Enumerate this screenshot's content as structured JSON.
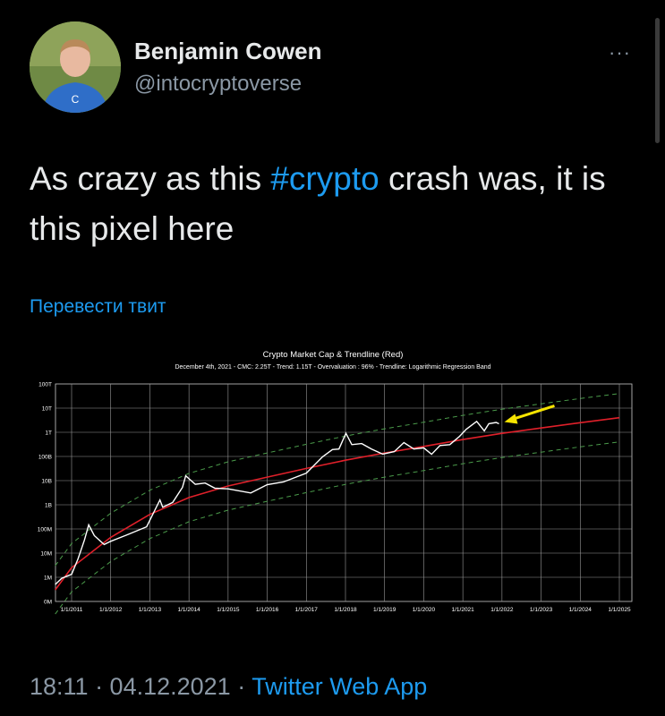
{
  "author": {
    "name": "Benjamin Cowen",
    "handle": "@intocryptoverse",
    "avatar_shirt_logo": "C"
  },
  "menu": {
    "label": "···",
    "icon": "more-dots-icon"
  },
  "tweet": {
    "text_part1": "As crazy as this ",
    "hashtag": "#crypto",
    "text_part2": " crash was, it is this pixel here"
  },
  "translate_label": "Перевести твит",
  "chart_data": {
    "type": "line",
    "title": "Crypto Market Cap & Trendline (Red)",
    "subtitle": "December 4th, 2021 - CMC: 2.25T - Trend: 1.15T - Overvaluation : 96% - Trendline: Logarithmic Regression Band",
    "y_scale": "log",
    "y_ticks": [
      "0M",
      "1M",
      "10M",
      "100M",
      "1B",
      "10B",
      "100B",
      "1T",
      "10T",
      "100T"
    ],
    "x_ticks": [
      "1/1/2011",
      "1/1/2012",
      "1/1/2013",
      "1/1/2014",
      "1/1/2015",
      "1/1/2016",
      "1/1/2017",
      "1/1/2018",
      "1/1/2019",
      "1/1/2020",
      "1/1/2021",
      "1/1/2022",
      "1/1/2023",
      "1/1/2024",
      "1/1/2025"
    ],
    "grid": true,
    "series": [
      {
        "color": "#ffffff",
        "dates": [
          "2010-08-01",
          "2010-10-01",
          "2011-01-01",
          "2011-03-01",
          "2011-05-01",
          "2011-06-10",
          "2011-08-01",
          "2011-11-01",
          "2012-01-01",
          "2012-06-01",
          "2012-12-01",
          "2013-04-05",
          "2013-05-01",
          "2013-08-01",
          "2013-11-01",
          "2013-12-01",
          "2014-03-01",
          "2014-06-01",
          "2014-09-01",
          "2015-01-01",
          "2015-08-01",
          "2016-01-01",
          "2016-06-01",
          "2017-01-01",
          "2017-06-01",
          "2017-09-01",
          "2017-11-01",
          "2018-01-05",
          "2018-03-01",
          "2018-06-01",
          "2018-09-01",
          "2018-12-15",
          "2019-04-01",
          "2019-07-01",
          "2019-10-01",
          "2020-01-01",
          "2020-03-15",
          "2020-06-01",
          "2020-09-01",
          "2020-12-01",
          "2021-02-01",
          "2021-05-10",
          "2021-07-20",
          "2021-09-01",
          "2021-11-08",
          "2021-12-04"
        ],
        "values": [
          0.5,
          0.8,
          1.5,
          5,
          40,
          130,
          60,
          20,
          35,
          50,
          140,
          1400,
          900,
          1100,
          6000,
          14000,
          8000,
          7000,
          5500,
          4000,
          3500,
          6000,
          10000,
          18000,
          110000,
          170000,
          230000,
          800000,
          350000,
          300000,
          230000,
          110000,
          180000,
          330000,
          230000,
          200000,
          140000,
          250000,
          350000,
          600000,
          1500000,
          2500000,
          1300000,
          2000000,
          2900000,
          2250000
        ]
      },
      {
        "color": "#e0202a",
        "dates": [
          "2010-08-01",
          "2011-01-01",
          "2012-01-01",
          "2013-01-01",
          "2014-01-01",
          "2015-01-01",
          "2016-01-01",
          "2017-01-01",
          "2018-01-01",
          "2019-01-01",
          "2020-01-01",
          "2021-01-01",
          "2022-01-01",
          "2023-01-01",
          "2024-01-01",
          "2025-01-01"
        ],
        "values": [
          0.3,
          2.5,
          45,
          400,
          2000,
          6000,
          14000,
          32000,
          70000,
          140000,
          260000,
          500000,
          900000,
          1500000,
          2500000,
          4000000
        ]
      },
      {
        "color": "#4a9a4a",
        "dates": [
          "2010-08-01",
          "2011-01-01",
          "2012-01-01",
          "2013-01-01",
          "2014-01-01",
          "2015-01-01",
          "2016-01-01",
          "2017-01-01",
          "2018-01-01",
          "2019-01-01",
          "2020-01-01",
          "2021-01-01",
          "2022-01-01",
          "2023-01-01",
          "2024-01-01",
          "2025-01-01"
        ],
        "values": [
          3,
          25,
          450,
          4000,
          20000,
          60000,
          140000,
          320000,
          700000,
          1400000,
          2600000,
          5000000,
          9000000,
          15000000,
          25000000,
          40000000
        ]
      },
      {
        "color": "#4a9a4a",
        "dates": [
          "2010-08-01",
          "2011-01-01",
          "2012-01-01",
          "2013-01-01",
          "2014-01-01",
          "2015-01-01",
          "2016-01-01",
          "2017-01-01",
          "2018-01-01",
          "2019-01-01",
          "2020-01-01",
          "2021-01-01",
          "2022-01-01",
          "2023-01-01",
          "2024-01-01",
          "2025-01-01"
        ],
        "values": [
          0.03,
          0.25,
          4.5,
          40,
          200,
          600,
          1400,
          3200,
          7000,
          14000,
          26000,
          50000,
          90000,
          150000,
          250000,
          400000
        ]
      }
    ],
    "arrow_color": "#f5e400"
  },
  "footer": {
    "time_date": "18:11 · 04.12.2021 · ",
    "app": "Twitter Web App"
  }
}
